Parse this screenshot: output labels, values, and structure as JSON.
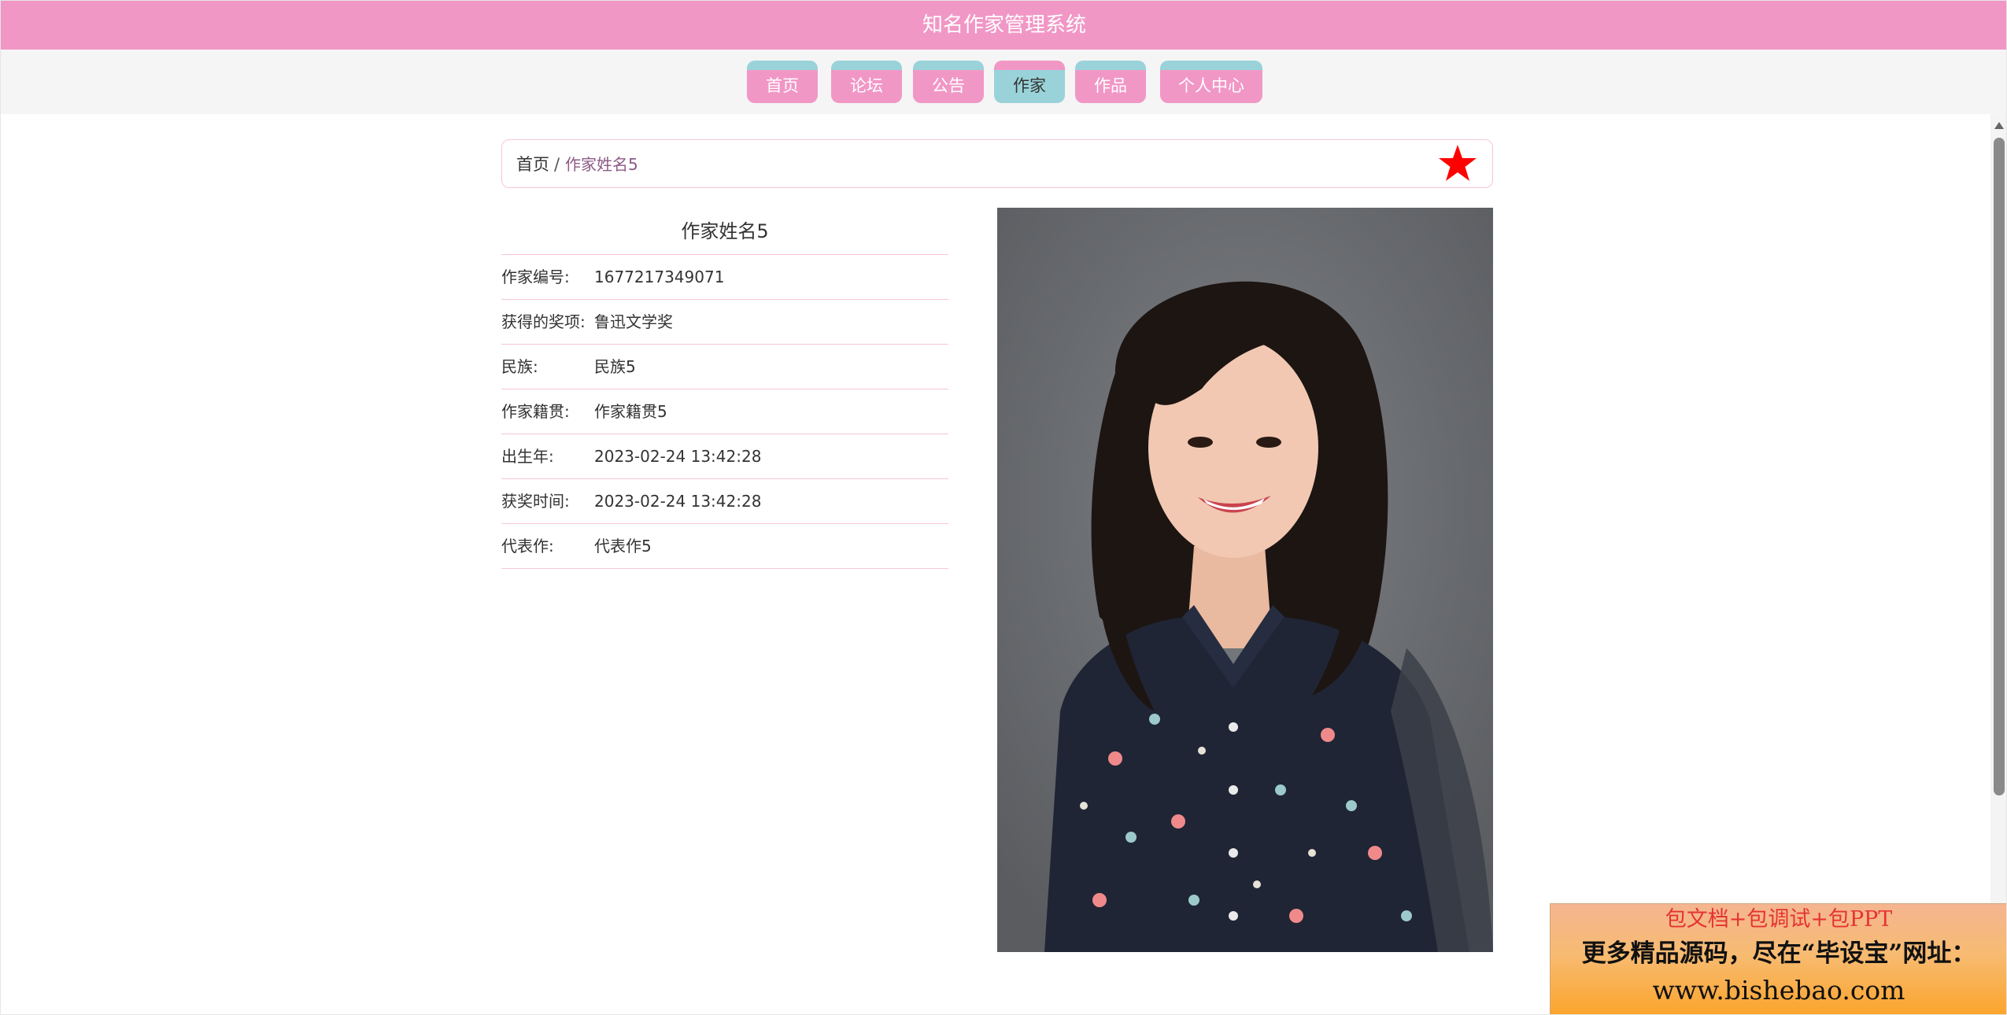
{
  "app": {
    "title": "知名作家管理系统"
  },
  "nav": {
    "items": [
      {
        "label": "首页"
      },
      {
        "label": "论坛"
      },
      {
        "label": "公告"
      },
      {
        "label": "作家"
      },
      {
        "label": "作品"
      },
      {
        "label": "个人中心"
      }
    ],
    "active": "作家"
  },
  "breadcrumb": {
    "home": "首页",
    "separator": "/",
    "current": "作家姓名5"
  },
  "favorite": {
    "icon": "star-icon",
    "color": "#ff0000"
  },
  "detail": {
    "title": "作家姓名5",
    "rows": [
      {
        "label": "作家编号:",
        "value": "1677217349071"
      },
      {
        "label": "获得的奖项:",
        "value": "鲁迅文学奖"
      },
      {
        "label": "民族:",
        "value": "民族5"
      },
      {
        "label": "作家籍贯:",
        "value": "作家籍贯5"
      },
      {
        "label": "出生年:",
        "value": "2023-02-24 13:42:28"
      },
      {
        "label": "获奖时间:",
        "value": "2023-02-24 13:42:28"
      },
      {
        "label": "代表作:",
        "value": "代表作5"
      }
    ]
  },
  "ad": {
    "line1": "包文档+包调试+包PPT",
    "line2": "更多精品源码，尽在“毕设宝”网址：",
    "line3": "www.bishebao.com"
  },
  "colors": {
    "primary_pink": "#f197c6",
    "accent_teal": "#99d3d9",
    "border_pink": "#f6c6da"
  }
}
